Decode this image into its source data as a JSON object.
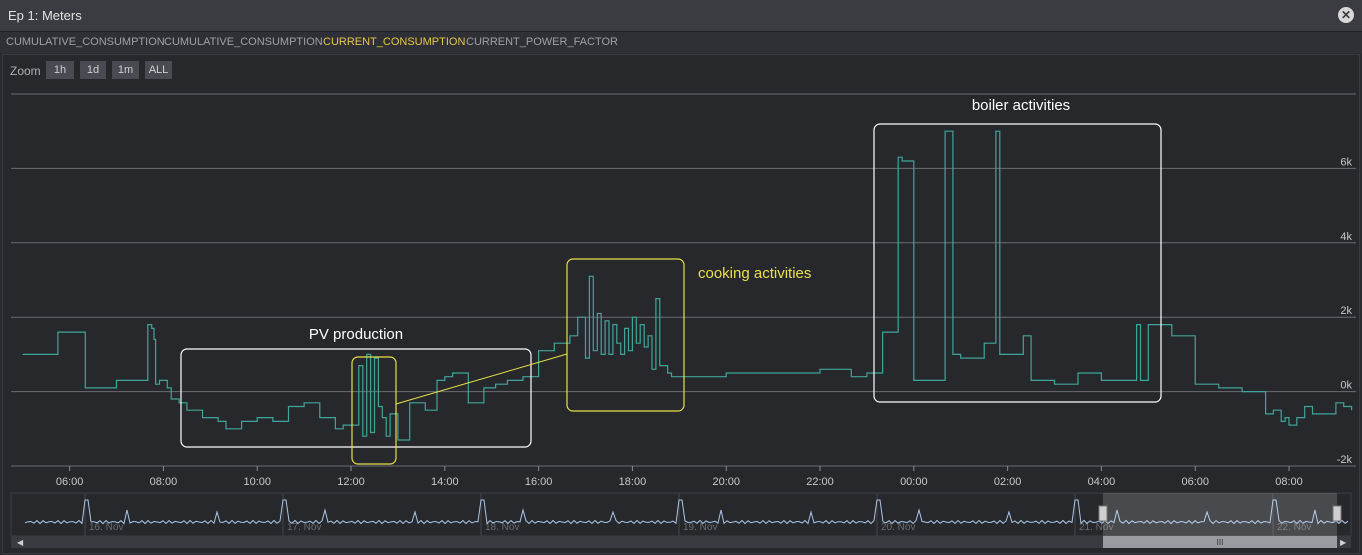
{
  "window": {
    "title": "Ep 1: Meters"
  },
  "tabs": [
    {
      "label": "CUMULATIVE_CONSUMPTION",
      "active": false
    },
    {
      "label": "CUMULATIVE_CONSUMPTION",
      "active": false
    },
    {
      "label": "CURRENT_CONSUMPTION",
      "active": true
    },
    {
      "label": "CURRENT_POWER_FACTOR",
      "active": false
    }
  ],
  "zoom": {
    "label": "Zoom",
    "buttons": [
      "1h",
      "1d",
      "1m",
      "ALL"
    ]
  },
  "colors": {
    "line": "#3fa59a",
    "navigator": "#a9c6e8",
    "annotation_white": "#ffffff",
    "annotation_yellow": "#e8e04a",
    "active_tab": "#e6c84a"
  },
  "chart_data": {
    "type": "line",
    "title": "",
    "xlabel": "",
    "ylabel": "",
    "x_ticks": [
      "06:00",
      "08:00",
      "10:00",
      "12:00",
      "14:00",
      "16:00",
      "18:00",
      "20:00",
      "22:00",
      "00:00",
      "02:00",
      "04:00",
      "06:00",
      "08:00"
    ],
    "y_ticks": [
      "-2k",
      "0k",
      "2k",
      "4k",
      "6k"
    ],
    "ylim": [
      -2000,
      8000
    ],
    "grid": true,
    "series": [
      {
        "x": [
          "05:00",
          "05:40",
          "05:45",
          "06:20",
          "06:50",
          "07:00",
          "07:30",
          "07:40",
          "07:45",
          "07:48",
          "07:50",
          "07:55",
          "08:05",
          "08:10",
          "08:20",
          "08:30",
          "08:50",
          "09:10",
          "09:20",
          "09:40",
          "10:00",
          "10:20",
          "10:40",
          "11:00",
          "11:20",
          "11:40",
          "11:50",
          "12:10",
          "12:15",
          "12:20",
          "12:25",
          "12:30",
          "12:35",
          "12:40",
          "12:45",
          "12:50",
          "13:00",
          "13:15",
          "13:35",
          "13:50",
          "14:00",
          "14:10",
          "14:30",
          "14:50",
          "15:05",
          "15:20",
          "15:40",
          "16:00",
          "16:20",
          "16:40",
          "16:50",
          "17:00",
          "17:05",
          "17:10",
          "17:15",
          "17:20",
          "17:25",
          "17:30",
          "17:35",
          "17:40",
          "17:45",
          "17:50",
          "17:55",
          "18:00",
          "18:05",
          "18:10",
          "18:15",
          "18:20",
          "18:25",
          "18:30",
          "18:35",
          "18:40",
          "18:45",
          "18:50",
          "19:00",
          "19:30",
          "20:00",
          "21:00",
          "22:00",
          "22:40",
          "23:00",
          "23:20",
          "23:40",
          "23:45",
          "24:00",
          "24:10",
          "24:40",
          "24:50",
          "25:00",
          "25:30",
          "25:45",
          "25:50",
          "26:20",
          "26:30",
          "27:00",
          "27:30",
          "28:00",
          "28:30",
          "28:45",
          "28:50",
          "29:00",
          "29:30",
          "30:00",
          "30:30",
          "31:00",
          "31:30",
          "31:40",
          "31:50",
          "31:55",
          "32:00",
          "32:10",
          "32:20",
          "32:30",
          "33:00",
          "33:10",
          "33:20"
        ],
        "y": [
          1000,
          1000,
          1600,
          100,
          100,
          300,
          300,
          1800,
          1700,
          1400,
          200,
          300,
          100,
          -200,
          -300,
          -500,
          -700,
          -800,
          -1000,
          -800,
          -700,
          -800,
          -400,
          -300,
          -700,
          -1000,
          -900,
          700,
          -1200,
          1000,
          -1100,
          900,
          -400,
          -700,
          -1200,
          -600,
          -1300,
          -300,
          -500,
          300,
          400,
          500,
          -300,
          100,
          200,
          300,
          400,
          1100,
          1300,
          1500,
          2000,
          900,
          3100,
          1100,
          2100,
          1000,
          1900,
          1000,
          1800,
          1300,
          1000,
          1700,
          1100,
          2000,
          1300,
          1800,
          1200,
          1500,
          600,
          2500,
          700,
          700,
          500,
          400,
          400,
          400,
          500,
          500,
          600,
          400,
          500,
          1600,
          6300,
          6200,
          300,
          300,
          7000,
          1000,
          900,
          1300,
          7000,
          1000,
          1500,
          300,
          200,
          500,
          300,
          300,
          1800,
          300,
          1800,
          1500,
          200,
          100,
          0,
          -600,
          -500,
          -800,
          -700,
          -900,
          -700,
          -400,
          -600,
          -300,
          -400,
          -500
        ]
      }
    ],
    "navigator": {
      "x_ticks": [
        "16. Nov",
        "17. Nov",
        "18. Nov",
        "19. Nov",
        "20. Nov",
        "21. Nov",
        "22. Nov"
      ]
    },
    "annotations": [
      {
        "text": "PV production",
        "color": "white"
      },
      {
        "text": "cooking activities",
        "color": "yellow"
      },
      {
        "text": "boiler  activities",
        "color": "white"
      }
    ]
  }
}
